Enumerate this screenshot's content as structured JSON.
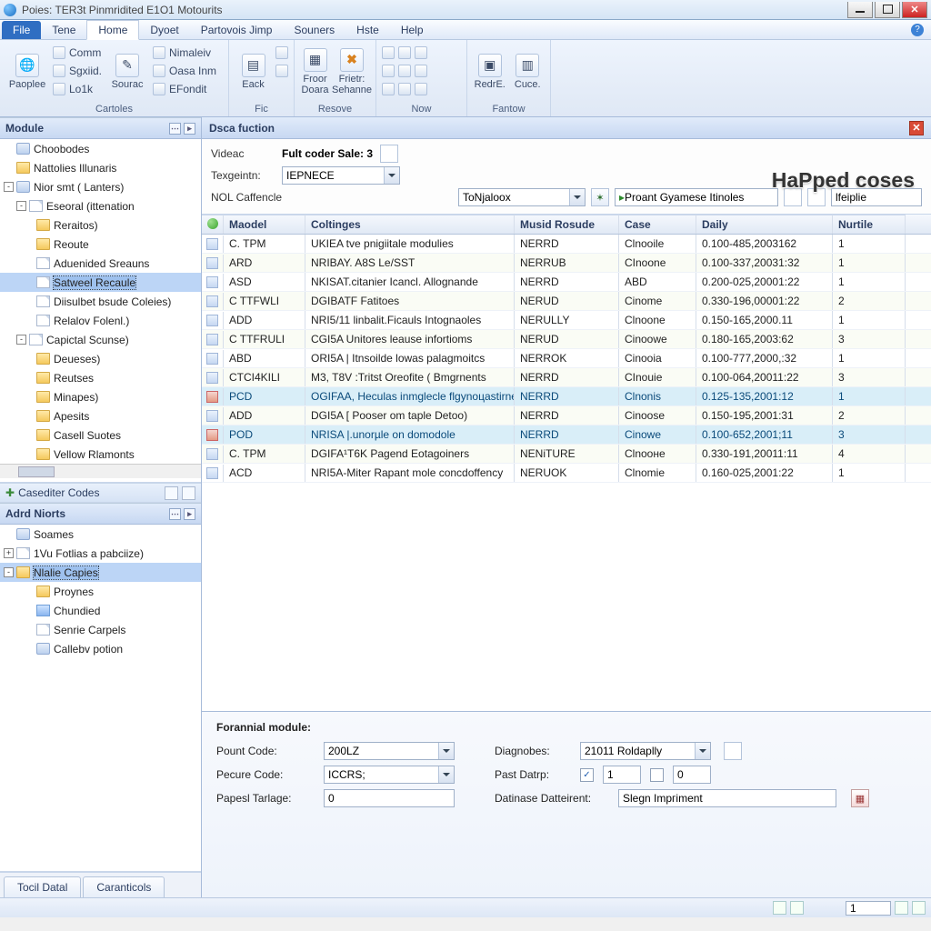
{
  "title": "Poies: TER3t Pinmridited E1O1 Motourits",
  "menus": {
    "file": "File",
    "items": [
      "Tene",
      "Home",
      "Dyoet",
      "Partovois Jimp",
      "Souners",
      "Hste",
      "Help"
    ],
    "activeIndex": 1
  },
  "ribbon": {
    "g1": {
      "caption": "Cartoles",
      "big": "Paoplee",
      "small": [
        "Comm",
        "Sgxiid.",
        "Lo1k"
      ],
      "big2": "Sourac",
      "small2": [
        "Nimaleiv",
        "Oasa Inm",
        "EFondit"
      ]
    },
    "g2": {
      "caption": "Fic",
      "big": "Eack"
    },
    "g3": {
      "caption": "Resove",
      "big1": "Froor\nDoara",
      "big2": "Frietr:\nSehanne"
    },
    "g4": {
      "caption": "Now"
    },
    "g5": {
      "caption": "Fantow",
      "big1": "RedrE.",
      "big2": "Cuce."
    }
  },
  "leftPanel": {
    "title": "Module"
  },
  "tree": [
    {
      "lev": 0,
      "ico": "db",
      "label": "Choobodes",
      "exp": ""
    },
    {
      "lev": 0,
      "ico": "folder",
      "label": "Nattolies Illunaris"
    },
    {
      "lev": 0,
      "ico": "db",
      "label": "Nior smt ( Lanters)",
      "exp": "-"
    },
    {
      "lev": 1,
      "ico": "page",
      "label": "Eseoral (ittenation",
      "exp": "-"
    },
    {
      "lev": 2,
      "ico": "folder",
      "label": "Reraitos)"
    },
    {
      "lev": 2,
      "ico": "folder",
      "label": "Reoute"
    },
    {
      "lev": 2,
      "ico": "page",
      "label": "Aduenided Sreauns"
    },
    {
      "lev": 2,
      "ico": "page",
      "label": "Satweel Recaule",
      "sel": true
    },
    {
      "lev": 2,
      "ico": "page",
      "label": "Diisulbet bsude Coleies)"
    },
    {
      "lev": 2,
      "ico": "page",
      "label": "Relalov Folenl.)"
    },
    {
      "lev": 1,
      "ico": "page",
      "label": "Capictal Scunse)",
      "exp": "-"
    },
    {
      "lev": 2,
      "ico": "folder",
      "label": "Deueses)"
    },
    {
      "lev": 2,
      "ico": "folder",
      "label": "Reutses"
    },
    {
      "lev": 2,
      "ico": "folder",
      "label": "Minapes)"
    },
    {
      "lev": 2,
      "ico": "folder",
      "label": "Apesits"
    },
    {
      "lev": 2,
      "ico": "folder",
      "label": "Casell Suotes"
    },
    {
      "lev": 2,
      "ico": "folder",
      "label": "Vellow Rlamonts"
    }
  ],
  "midrow": {
    "label": "Casediter Codes"
  },
  "panel2": {
    "title": "Adrd Niorts"
  },
  "tree2": [
    {
      "lev": 0,
      "ico": "db",
      "label": "Soames"
    },
    {
      "lev": 0,
      "ico": "page",
      "label": "1Vu Fotlias a pabciize)",
      "exp": "+"
    },
    {
      "lev": 0,
      "ico": "folder",
      "label": "Nlalie Capies",
      "exp": "-",
      "sel": true
    },
    {
      "lev": 2,
      "ico": "folder",
      "label": "Proynes"
    },
    {
      "lev": 2,
      "ico": "blue",
      "label": "Chundied"
    },
    {
      "lev": 2,
      "ico": "page",
      "label": "Senrie Carpels"
    },
    {
      "lev": 2,
      "ico": "db",
      "label": "Callebv potion"
    }
  ],
  "righthdr": "Dsca fuction",
  "filter": {
    "l1": "Videac",
    "v1": "Fult coder Sale: 3",
    "l2": "Texgeintn:",
    "v2": "IEPNECE",
    "l3": "NOL Caffencle",
    "combo1": "ToNjaloox",
    "combo2": "Proant Gyamese Itinoles",
    "combo3": "lfeiplie"
  },
  "watermark": "HaPped coses",
  "cols": [
    "Maodel",
    "Coltinges",
    "Musid Rosude",
    "Case",
    "Daily",
    "Nurtile"
  ],
  "rows": [
    {
      "m": "C. TPM",
      "c": "UKIEA tve pnigiitale modulies",
      "r": "NERRD",
      "s": "Clnoоile",
      "d": "0.100-485,2003162",
      "n": "1"
    },
    {
      "m": "ARD",
      "c": "NRIBAY. A8S Le/SST",
      "r": "NERRUB",
      "s": "CInoone",
      "d": "0.100-337,20031:32",
      "n": "1"
    },
    {
      "m": "ASD",
      "c": "NKISAT.citanier Icancl. Allognande",
      "r": "NERRD",
      "s": "ABD",
      "d": "0.200-025,20001:22",
      "n": "1"
    },
    {
      "m": "C TTFWLI",
      "c": "DGIBATF Fatitoes",
      "r": "NERUD",
      "s": "Cinоme",
      "d": "0.330-196,00001:22",
      "n": "2"
    },
    {
      "m": "ADD",
      "c": "NRI5/11 linbalit.Ficauls Intognaoles",
      "r": "NERULLY",
      "s": "Clnoone",
      "d": "0.150-165,2000.11",
      "n": "1"
    },
    {
      "m": "C TTFRULI",
      "c": "CGI5A Unitores leause infortioms",
      "r": "NERUD",
      "s": "Cinoowe",
      "d": "0.180-165,2003:62",
      "n": "3"
    },
    {
      "m": "ABD",
      "c": "ORI5A | Itnsoilde lowas palagmoitcs",
      "r": "NERROK",
      "s": "Cinoоia",
      "d": "0.100-777,2000,:32",
      "n": "1"
    },
    {
      "m": "CTCI4KILI",
      "c": "M3, T8V :Tritst Oreofite ( Bmgrnents",
      "r": "NERRD",
      "s": "CInouie",
      "d": "0.100-064,20011:22",
      "n": "3"
    },
    {
      "m": "PCD",
      "c": "OGIFAA, Heculas inmglecle flgynoцastirne",
      "r": "NERRD",
      "s": "Clnonis",
      "d": "0.125-135,2001:12",
      "n": "1",
      "hl": true
    },
    {
      "m": "ADD",
      "c": "DGI5A [ Pooser om taple Detoo)",
      "r": "NERRD",
      "s": "Cinoose",
      "d": "0.150-195,2001:31",
      "n": "2"
    },
    {
      "m": "POD",
      "c": "NRISA |.unorµle on domodole",
      "r": "NERRD",
      "s": "Cinowe",
      "d": "0.100-652,2001;11",
      "n": "3",
      "hl": true
    },
    {
      "m": "C. TPM",
      "c": "DGIFA¹T6K Pagend Eotagoiners",
      "r": "NENiTURE",
      "s": "Clnooнe",
      "d": "0.330-191,20011:11",
      "n": "4"
    },
    {
      "m": "ACD",
      "c": "NRI5A-Miter Rapant mole concdoffency",
      "r": "NERUOK",
      "s": "Clnomie",
      "d": "0.160-025,2001:22",
      "n": "1"
    }
  ],
  "detail": {
    "title": "Forannial module:",
    "l1": "Pount Code:",
    "v1": "200LZ",
    "l2": "Pecure Code:",
    "v2": "ICCRS;",
    "l3": "Papesl Tarlage:",
    "v3": "0",
    "r1": "Diagnobes:",
    "rv1": "21011 Roldaplly",
    "r2": "Past Datrp:",
    "rv2a": "1",
    "rv2b": "0",
    "r3": "Datinase Datteirent:",
    "rv3": "Slegn Impгiment"
  },
  "tabs": [
    "Tocil Datal",
    "Caranticols"
  ],
  "status": {
    "page": "1"
  }
}
